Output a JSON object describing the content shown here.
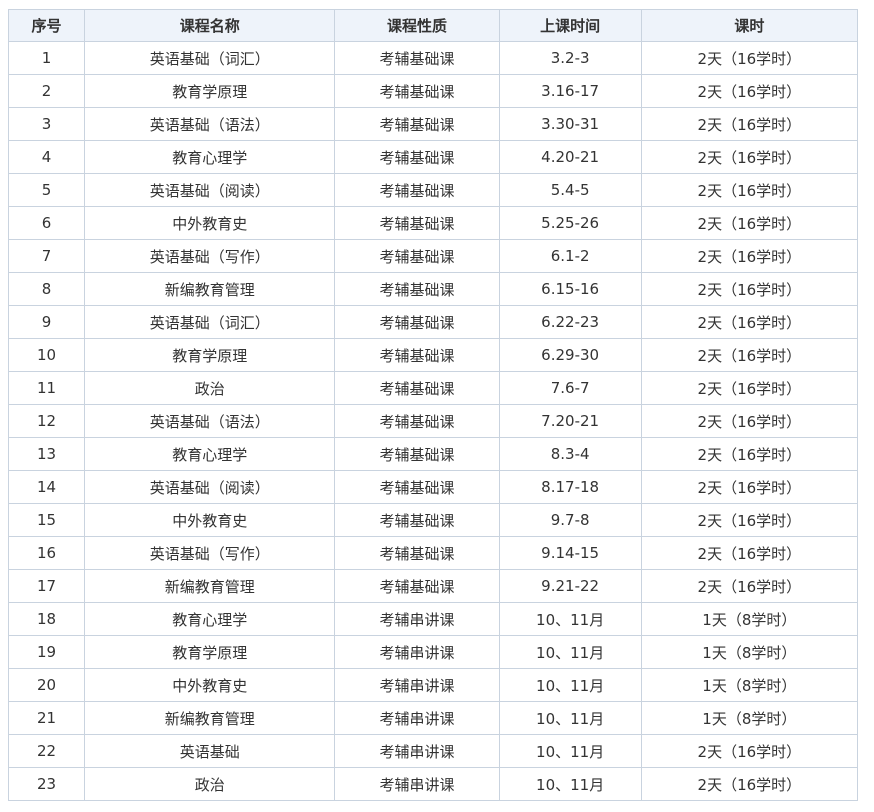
{
  "table": {
    "headers": [
      "序号",
      "课程名称",
      "课程性质",
      "上课时间",
      "课时"
    ],
    "rows": [
      [
        "1",
        "英语基础（词汇）",
        "考辅基础课",
        "3.2-3",
        "2天（16学时）"
      ],
      [
        "2",
        "教育学原理",
        "考辅基础课",
        "3.16-17",
        "2天（16学时）"
      ],
      [
        "3",
        "英语基础（语法）",
        "考辅基础课",
        "3.30-31",
        "2天（16学时）"
      ],
      [
        "4",
        "教育心理学",
        "考辅基础课",
        "4.20-21",
        "2天（16学时）"
      ],
      [
        "5",
        "英语基础（阅读）",
        "考辅基础课",
        "5.4-5",
        "2天（16学时）"
      ],
      [
        "6",
        "中外教育史",
        "考辅基础课",
        "5.25-26",
        "2天（16学时）"
      ],
      [
        "7",
        "英语基础（写作）",
        "考辅基础课",
        "6.1-2",
        "2天（16学时）"
      ],
      [
        "8",
        "新编教育管理",
        "考辅基础课",
        "6.15-16",
        "2天（16学时）"
      ],
      [
        "9",
        "英语基础（词汇）",
        "考辅基础课",
        "6.22-23",
        "2天（16学时）"
      ],
      [
        "10",
        "教育学原理",
        "考辅基础课",
        "6.29-30",
        "2天（16学时）"
      ],
      [
        "11",
        "政治",
        "考辅基础课",
        "7.6-7",
        "2天（16学时）"
      ],
      [
        "12",
        "英语基础（语法）",
        "考辅基础课",
        "7.20-21",
        "2天（16学时）"
      ],
      [
        "13",
        "教育心理学",
        "考辅基础课",
        "8.3-4",
        "2天（16学时）"
      ],
      [
        "14",
        "英语基础（阅读）",
        "考辅基础课",
        "8.17-18",
        "2天（16学时）"
      ],
      [
        "15",
        "中外教育史",
        "考辅基础课",
        "9.7-8",
        "2天（16学时）"
      ],
      [
        "16",
        "英语基础（写作）",
        "考辅基础课",
        "9.14-15",
        "2天（16学时）"
      ],
      [
        "17",
        "新编教育管理",
        "考辅基础课",
        "9.21-22",
        "2天（16学时）"
      ],
      [
        "18",
        "教育心理学",
        "考辅串讲课",
        "10、11月",
        "1天（8学时）"
      ],
      [
        "19",
        "教育学原理",
        "考辅串讲课",
        "10、11月",
        "1天（8学时）"
      ],
      [
        "20",
        "中外教育史",
        "考辅串讲课",
        "10、11月",
        "1天（8学时）"
      ],
      [
        "21",
        "新编教育管理",
        "考辅串讲课",
        "10、11月",
        "1天（8学时）"
      ],
      [
        "22",
        "英语基础",
        "考辅串讲课",
        "10、11月",
        "2天（16学时）"
      ],
      [
        "23",
        "政治",
        "考辅串讲课",
        "10、11月",
        "2天（16学时）"
      ]
    ]
  },
  "colors": {
    "header_bg": "#eef3fa",
    "border": "#c9d3df",
    "text": "#333333"
  }
}
